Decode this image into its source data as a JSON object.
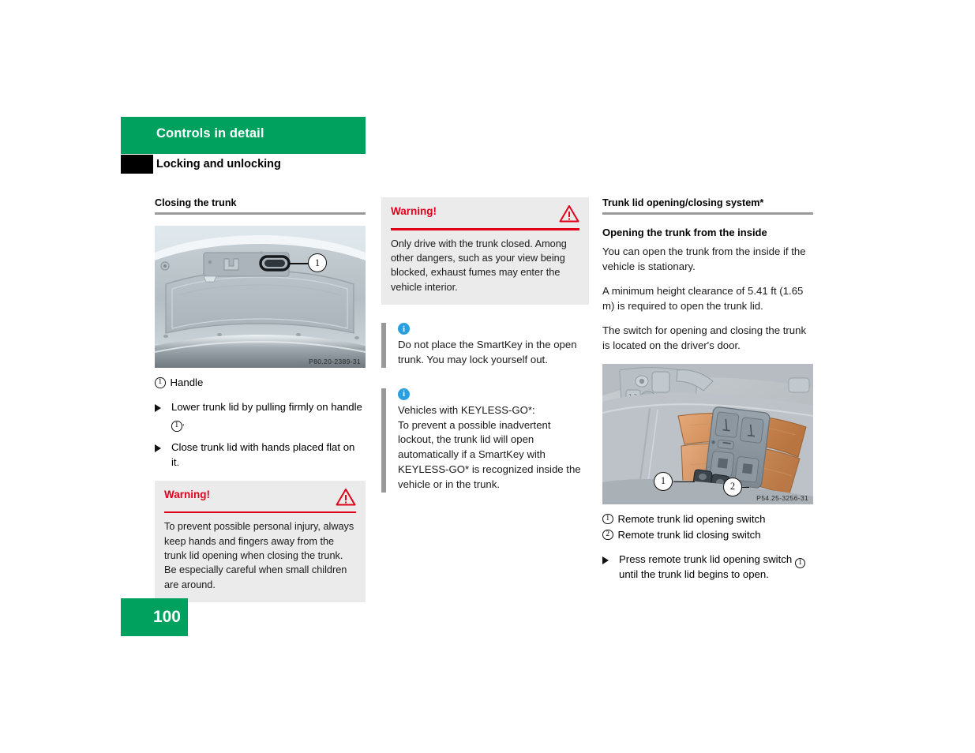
{
  "header": {
    "chapter": "Controls in detail",
    "section": "Locking and unlocking"
  },
  "left_column": {
    "heading": "Closing the trunk",
    "figure": {
      "code": "P80.20-2389-31",
      "callout_1": "1"
    },
    "legend": [
      {
        "num": "1",
        "text": "Handle"
      }
    ],
    "steps": [
      {
        "marker": "▶",
        "text_before": "Lower trunk lid by pulling firmly on handle ",
        "inline_num": "1",
        "text_after": "."
      },
      {
        "marker": "▶",
        "text_before": "Close trunk lid with hands placed flat on it.",
        "inline_num": "",
        "text_after": ""
      }
    ],
    "warning": {
      "title": "Warning!",
      "icon": "warning-triangle-icon",
      "body": "To prevent possible personal injury, always keep hands and fingers away from the trunk lid opening when closing the trunk. Be especially careful when small children are around."
    }
  },
  "middle_column": {
    "warning": {
      "title": "Warning!",
      "icon": "warning-triangle-icon",
      "body": "Only drive with the trunk closed. Among other dangers, such as your view being blocked, exhaust fumes may enter the vehicle interior."
    },
    "notes": [
      {
        "icon": "info-icon",
        "body": "Do not place the SmartKey in the open trunk. You may lock yourself out."
      },
      {
        "icon": "info-icon",
        "body": "Vehicles with KEYLESS-GO*:\nTo prevent a possible inadvertent lockout, the trunk lid will open automatically if a SmartKey with KEYLESS-GO* is recognized inside the vehicle or in the trunk."
      }
    ]
  },
  "right_column": {
    "heading": "Trunk lid opening/closing system*",
    "subheading": "Opening the trunk from the inside",
    "paragraphs": [
      "You can open the trunk from the inside if the vehicle is stationary.",
      "A minimum height clearance of 5.41 ft (1.65 m) is required to open the trunk lid.",
      "The switch for opening and closing the trunk is located on the driver's door."
    ],
    "figure": {
      "code": "P54.25-3256-31",
      "callout_1": "1",
      "callout_2": "2"
    },
    "legend": [
      {
        "num": "1",
        "text": "Remote trunk lid opening switch"
      },
      {
        "num": "2",
        "text": "Remote trunk lid closing switch"
      }
    ],
    "steps": [
      {
        "marker": "▶",
        "text_before": "Press remote trunk lid opening switch ",
        "inline_num": "1",
        "text_after": " until the trunk lid begins to open."
      }
    ]
  },
  "footer": {
    "page_number": "100"
  },
  "colors": {
    "brand_green": "#00a05e",
    "warning_red": "#e2001a",
    "info_blue": "#2a9fe0",
    "rule_gray": "#9a9a9a",
    "box_gray": "#ebebeb"
  }
}
